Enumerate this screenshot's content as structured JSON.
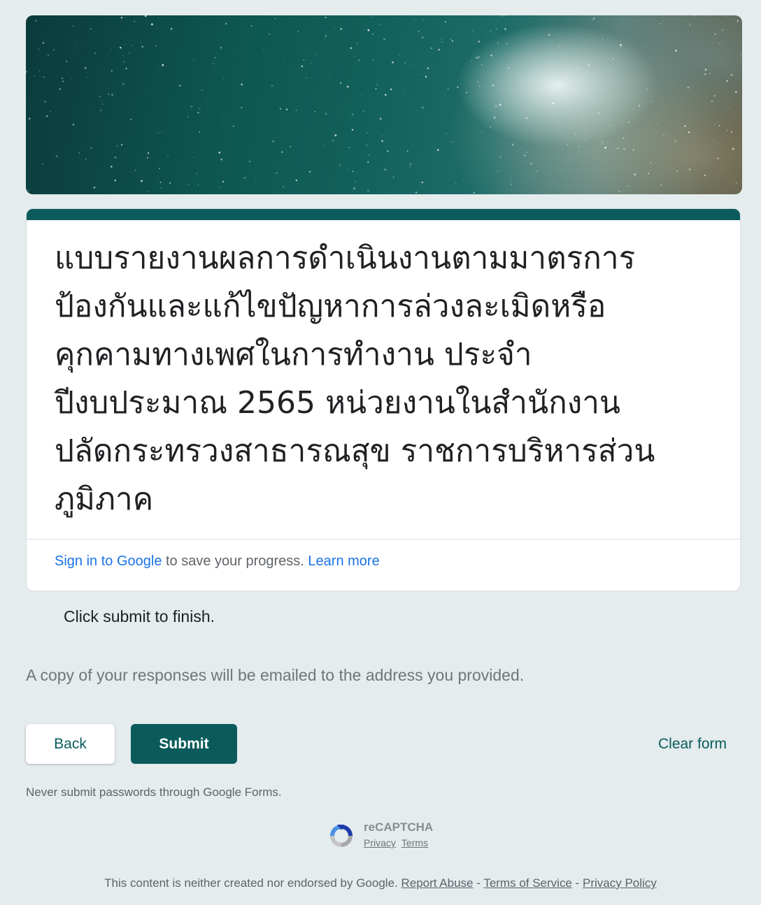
{
  "form": {
    "title": "แบบรายงานผลการดำเนินงานตามมาตรการป้องกันและแก้ไขปัญหาการล่วงละเมิดหรือคุกคามทางเพศในการทำงาน ประจำปีงบประมาณ 2565 หน่วยงานในสำนักงานปลัดกระทรวงสาธารณสุข  ราชการบริหารส่วนภูมิภาค",
    "title_lines": [
      "แบบรายงานผลการดำเนินงานตามมาตรการ",
      "ป้องกันและแก้ไขปัญหาการล่วงละเมิดหรือ",
      "คุกคามทางเพศในการทำงาน ประจำ",
      "ปีงบประมาณ 2565 หน่วยงานในสำนักงาน",
      "ปลัดกระทรวงสาธารณสุข  ราชการบริหารส่วน",
      "ภูมิภาค"
    ],
    "accent_color": "#0b5b5c",
    "background_color": "#e4ecee"
  },
  "signin": {
    "link_label": "Sign in to Google",
    "text": " to save your progress. ",
    "learn_more": "Learn more"
  },
  "messages": {
    "finish": "Click submit to finish.",
    "copy_notice": "A copy of your responses will be emailed to the address you provided.",
    "password_warning": "Never submit passwords through Google Forms."
  },
  "buttons": {
    "back": "Back",
    "submit": "Submit",
    "clear": "Clear form"
  },
  "recaptcha": {
    "name": "reCAPTCHA",
    "privacy": "Privacy",
    "terms": "Terms"
  },
  "footer": {
    "text": "This content is neither created nor endorsed by Google. ",
    "report_abuse": "Report Abuse",
    "separator": " - ",
    "terms_of_service": "Terms of Service",
    "privacy_policy": "Privacy Policy"
  },
  "icons": {
    "recaptcha_logo": "recaptcha-logo-icon"
  }
}
